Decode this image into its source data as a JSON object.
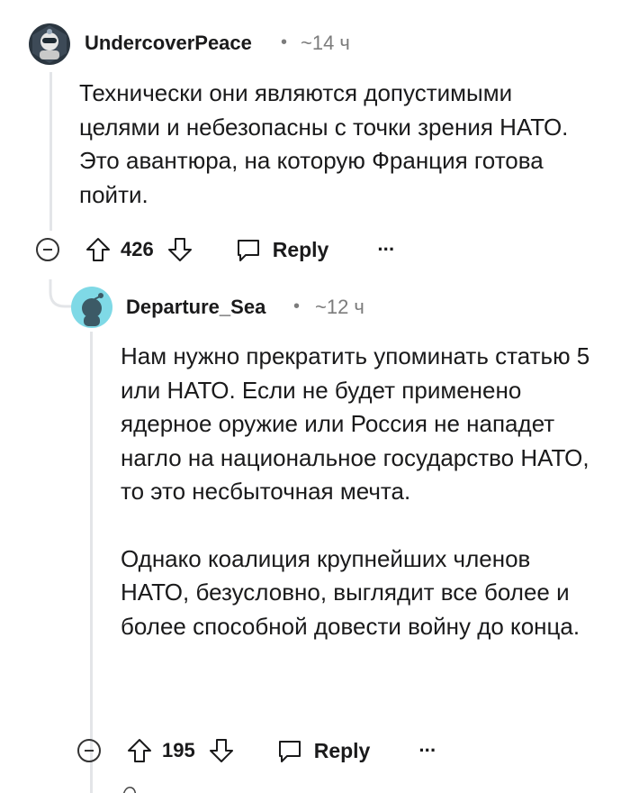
{
  "comment1": {
    "username": "UndercoverPeace",
    "separator": "•",
    "time": "~14 ч",
    "text": "Технически они являются допустимыми целями и небезопасны с точки зрения НАТО. Это авантюра, на которую Франция готова пойти.",
    "votes": "426",
    "reply_label": "Reply",
    "more_label": "···"
  },
  "comment2": {
    "username": "Departure_Sea",
    "separator": "•",
    "time": "~12 ч",
    "paragraphs": [
      "Нам нужно прекратить упоминать статью 5 или НАТО. Если не будет применено ядерное оружие или Россия не нападет нагло на национальное государство НАТО, то это несбыточная мечта.",
      "Однако коалиция крупнейших членов НАТО, безусловно, выглядит все более и более способной довести войну до конца."
    ],
    "votes": "195",
    "reply_label": "Reply",
    "more_label": "···"
  },
  "colors": {
    "thread_line": "#e3e5e8",
    "avatar2_bg": "#7fd9e6",
    "text": "#1a1a1b",
    "meta": "#7c7c7c"
  },
  "icons": [
    "avatar-icon",
    "collapse-icon",
    "upvote-icon",
    "downvote-icon",
    "comment-icon",
    "more-icon"
  ]
}
